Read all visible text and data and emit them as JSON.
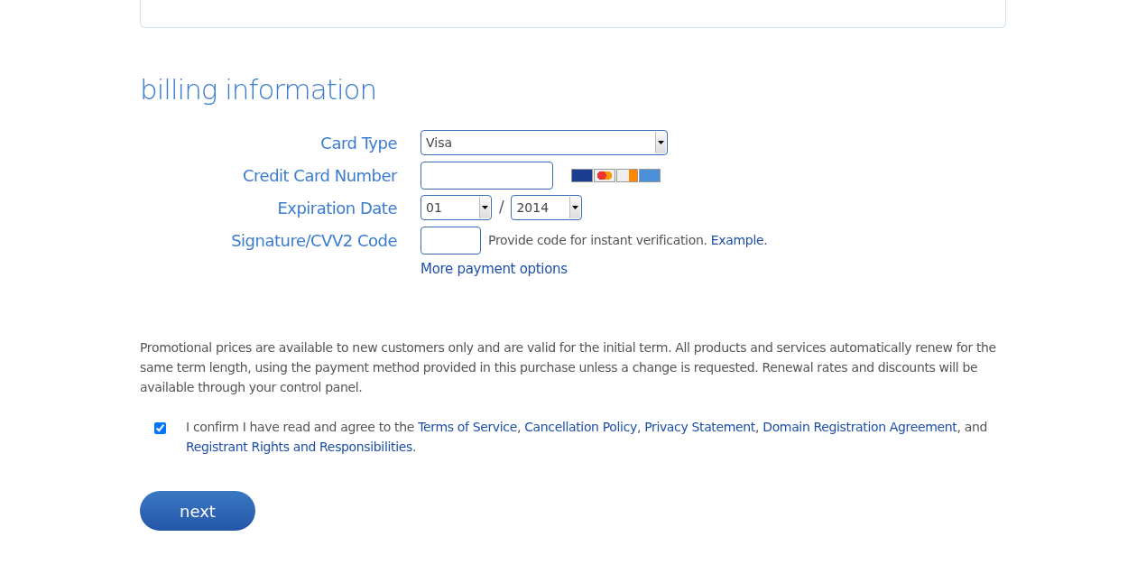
{
  "heading": "billing information",
  "fields": [
    {
      "kind": "select",
      "label": "Card Type",
      "value": "Visa"
    },
    {
      "kind": "text",
      "label": "Credit Card Number"
    },
    {
      "kind": "date",
      "label": "Expiration Date",
      "month": "01",
      "separator": "/",
      "year": "2014"
    },
    {
      "kind": "cvv",
      "label": "Signature/CVV2 Code",
      "hint": "Provide code for instant verification.",
      "link": "Example."
    }
  ],
  "more_link": "More payment options",
  "notice": "Promotional prices are available to new customers only and are valid for the initial term. All products and services automatically renew for the same term length, using the payment method provided in this purchase unless a change is requested. Renewal rates and discounts will be available through your control panel.",
  "agreement": {
    "checked": true,
    "parts": [
      {
        "kind": "text",
        "text": "I confirm I have read and agree to the "
      },
      {
        "kind": "link",
        "text": "Terms of Service"
      },
      {
        "kind": "text",
        "text": ", "
      },
      {
        "kind": "link",
        "text": "Cancellation Policy"
      },
      {
        "kind": "text",
        "text": ", "
      },
      {
        "kind": "link",
        "text": "Privacy Statement"
      },
      {
        "kind": "text",
        "text": ", "
      },
      {
        "kind": "link",
        "text": "Domain Registration Agreement"
      },
      {
        "kind": "text",
        "text": ", and "
      },
      {
        "kind": "link",
        "text": "Registrant Rights and Responsibilities"
      },
      {
        "kind": "text",
        "text": "."
      }
    ]
  },
  "next_button": "next"
}
